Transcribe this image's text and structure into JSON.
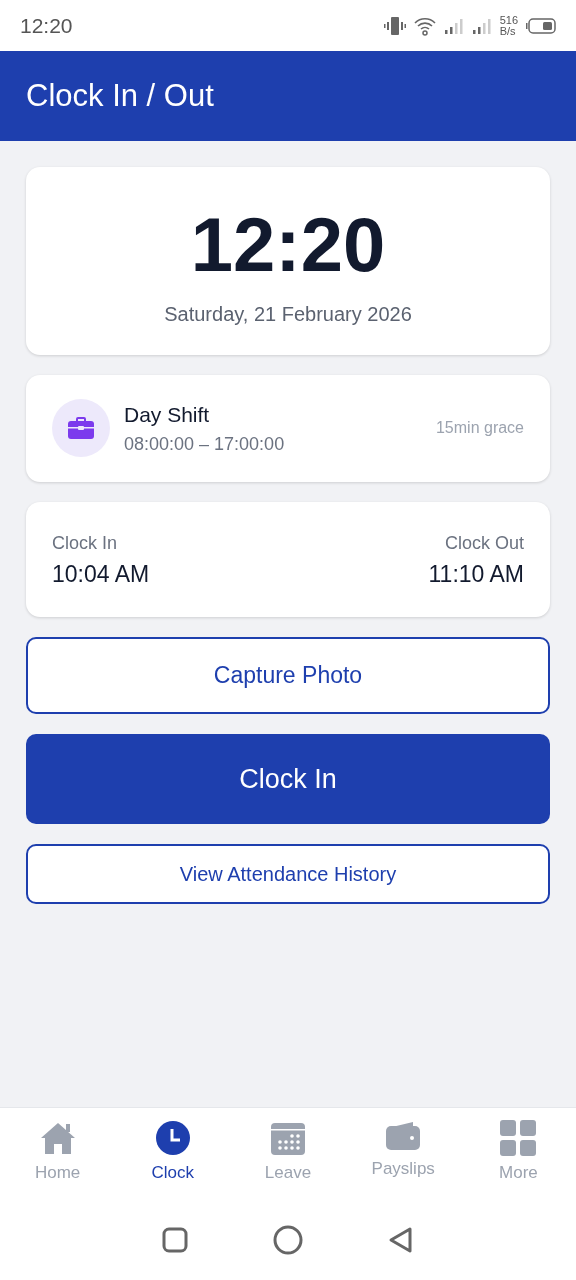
{
  "status_bar": {
    "time": "12:20",
    "speed_value": "516",
    "speed_unit": "B/s"
  },
  "header": {
    "title": "Clock In / Out"
  },
  "clock_card": {
    "time": "12:20",
    "date": "Saturday, 21 February 2026"
  },
  "shift_card": {
    "name": "Day Shift",
    "hours": "08:00:00 – 17:00:00",
    "grace": "15min grace"
  },
  "times_card": {
    "clock_in_label": "Clock In",
    "clock_in_time": "10:04 AM",
    "clock_out_label": "Clock Out",
    "clock_out_time": "11:10 AM"
  },
  "buttons": [
    {
      "label": "Capture Photo",
      "kind": "outline"
    },
    {
      "label": "Clock In",
      "kind": "primary"
    },
    {
      "label": "View Attendance History",
      "kind": "outline-small"
    }
  ],
  "bottom_nav": [
    {
      "label": "Home",
      "selected": false
    },
    {
      "label": "Clock",
      "selected": true
    },
    {
      "label": "Leave",
      "selected": false
    },
    {
      "label": "Payslips",
      "selected": false
    },
    {
      "label": "More",
      "selected": false
    }
  ]
}
